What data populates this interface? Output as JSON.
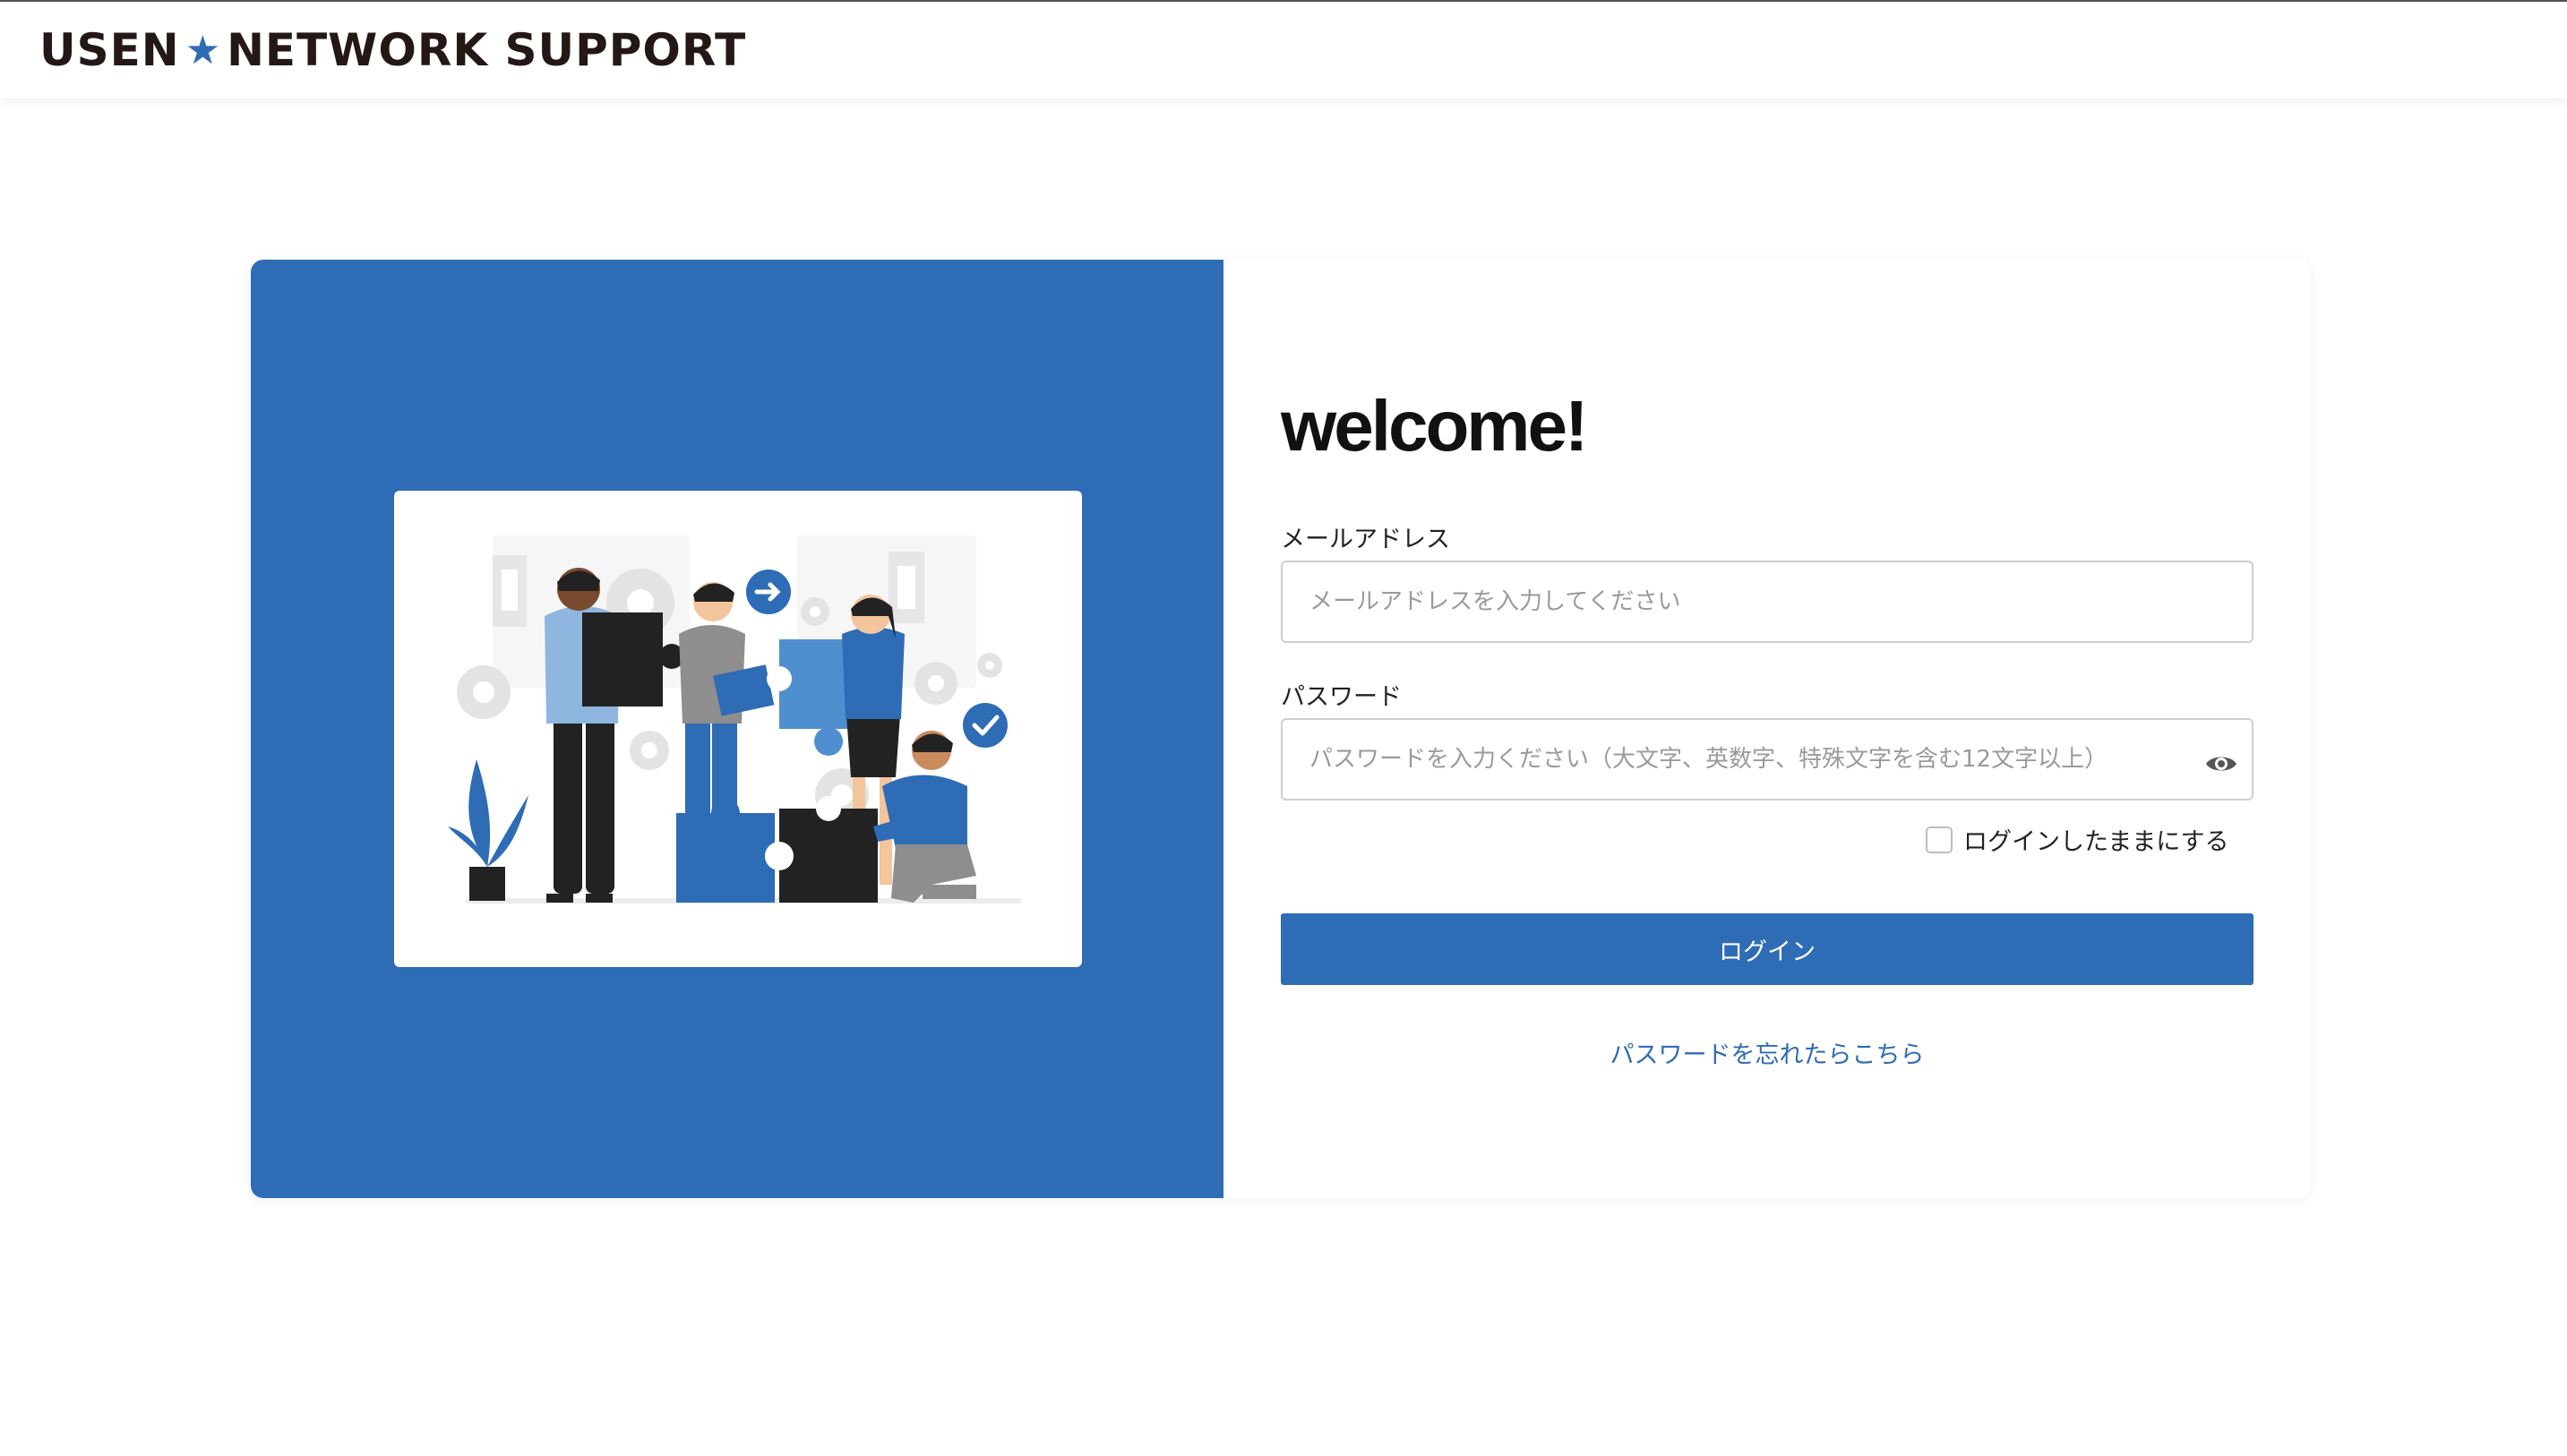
{
  "header": {
    "logo_left": "USEN",
    "logo_star": "★",
    "logo_right": "NETWORK SUPPORT"
  },
  "login": {
    "welcome": "welcome!",
    "email_label": "メールアドレス",
    "email_placeholder": "メールアドレスを入力してください",
    "email_value": "",
    "password_label": "パスワード",
    "password_placeholder": "パスワードを入力ください（大文字、英数字、特殊文字を含む12文字以上）",
    "password_value": "",
    "password_toggle_icon": "eye-icon",
    "remember_label": "ログインしたままにする",
    "remember_checked": false,
    "login_button": "ログイン",
    "forgot_link": "パスワードを忘れたらこちら"
  },
  "colors": {
    "brand": "#2e6cb5",
    "logo_text": "#231815",
    "illustration_dark": "#222222",
    "illustration_light_blue": "#8fb6de"
  },
  "illustration": {
    "icon": "teamwork-puzzle-illustration"
  }
}
